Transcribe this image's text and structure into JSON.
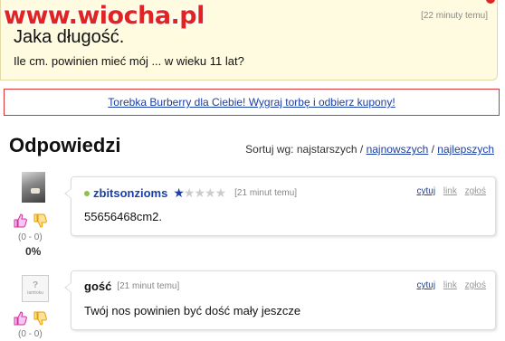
{
  "watermark": "www.wiocha.pl",
  "question": {
    "time": "[22 minuty temu]",
    "title": "Jaka długość.",
    "body": "Ile cm. powinien mieć mój ... w wieku 11 lat?"
  },
  "ad": {
    "link_text": "Torebka Burberry dla Ciebie! Wygraj torbę i odbierz kupony!"
  },
  "answers": {
    "heading": "Odpowiedzi",
    "sort": {
      "label": "Sortuj wg: najstarszych /",
      "newest": "najnowszych",
      "separator": "/",
      "best": "najlepszych"
    },
    "items": [
      {
        "votes": "(0 - 0)",
        "percent": "0%",
        "author": "zbitsonzioms",
        "rating_stars": 1,
        "time": "[21 minut temu]",
        "quote": "cytuj",
        "link": "link",
        "report": "zgłoś",
        "body": "55656468cm2."
      },
      {
        "votes": "(0 - 0)",
        "author": "gość",
        "time": "[21 minut temu]",
        "quote": "cytuj",
        "link": "link",
        "report": "zgłoś",
        "body": "Twój nos powinien być dość mały jeszcze",
        "avatar_text": "tamtoku"
      }
    ]
  },
  "colors": {
    "link": "#1a3fa6",
    "accent": "#e02424",
    "question_bg": "#fffbe0",
    "online": "#8bc34a"
  }
}
